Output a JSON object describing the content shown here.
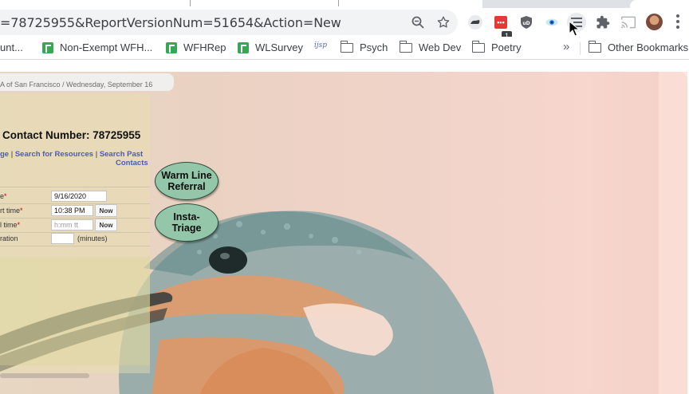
{
  "browser": {
    "url_text": "=78725955&ReportVersionNum=51654&Action=New",
    "extensions": {
      "red_ext_badge": "1"
    },
    "icons": [
      "zoom-icon",
      "star-icon",
      "shoe-extension-icon",
      "red-extension-icon",
      "ublock-icon",
      "eye-extension-icon",
      "list-extension-icon",
      "puzzle-icon",
      "cast-icon",
      "avatar",
      "menu-icon"
    ]
  },
  "bookmarks": {
    "items": [
      {
        "label": "unt..."
      },
      {
        "label": "Non-Exempt WFH..."
      },
      {
        "label": "WFHRep"
      },
      {
        "label": "WLSurvey"
      },
      {
        "label": ""
      },
      {
        "label": "Psych"
      },
      {
        "label": "Web Dev"
      },
      {
        "label": "Poetry"
      }
    ],
    "ijp_label": "ijsp",
    "more": "»",
    "other": "Other Bookmarks"
  },
  "page": {
    "info": "A of San Francisco / Wednesday, September 16",
    "contact_title": "Contact Number: 78725955",
    "links": {
      "link1": "ge",
      "sep1": "|",
      "link2": "Search for Resources",
      "sep2": "|",
      "link3a": "Search Past",
      "link3b": "Contacts"
    },
    "form": {
      "date_label": "e",
      "date_value": "9/16/2020",
      "start_label": "rt time",
      "start_value": "10:38 PM",
      "end_label": "l time",
      "end_placeholder": "h:mm tt",
      "duration_label": "ration",
      "duration_unit": "(minutes)",
      "required_mark": "*",
      "now_label": "Now"
    },
    "buttons": {
      "warm_line": "Warm Line Referral",
      "warm_line_l1": "Warm Line",
      "warm_line_l2": "Referral",
      "insta_l1": "Insta-",
      "insta_l2": "Triage"
    }
  },
  "colors": {
    "link": "#4c5ab8",
    "oval_fill": "#94c7aa",
    "required": "#cc0000"
  }
}
